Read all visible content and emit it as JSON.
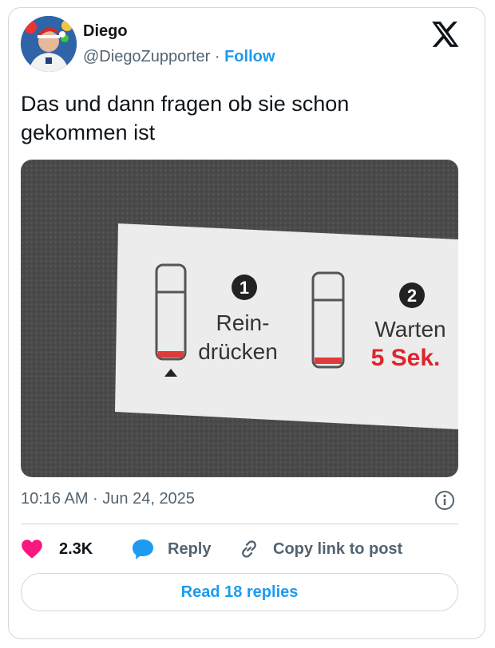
{
  "author": {
    "name": "Diego",
    "handle": "@DiegoZupporter",
    "separator": "·",
    "follow_label": "Follow"
  },
  "tweet": {
    "text": "Das und dann fragen ob sie schon gekommen ist",
    "timestamp": "10:16 AM · Jun 24, 2025"
  },
  "photo": {
    "step1": {
      "number": "1",
      "line1": "Rein-",
      "line2": "drücken"
    },
    "step2": {
      "number": "2",
      "line1": "Warten",
      "line2": "5 Sek."
    }
  },
  "actions": {
    "like_count": "2.3K",
    "reply_label": "Reply",
    "copy_label": "Copy link to post"
  },
  "read_replies_label": "Read 18 replies",
  "colors": {
    "link_blue": "#1d9bf0",
    "like_pink": "#f91880",
    "secondary_text": "#536471",
    "red_text": "#e0242c"
  },
  "icons": [
    "x-logo-icon",
    "info-icon",
    "heart-icon",
    "reply-bubble-icon",
    "link-icon"
  ]
}
